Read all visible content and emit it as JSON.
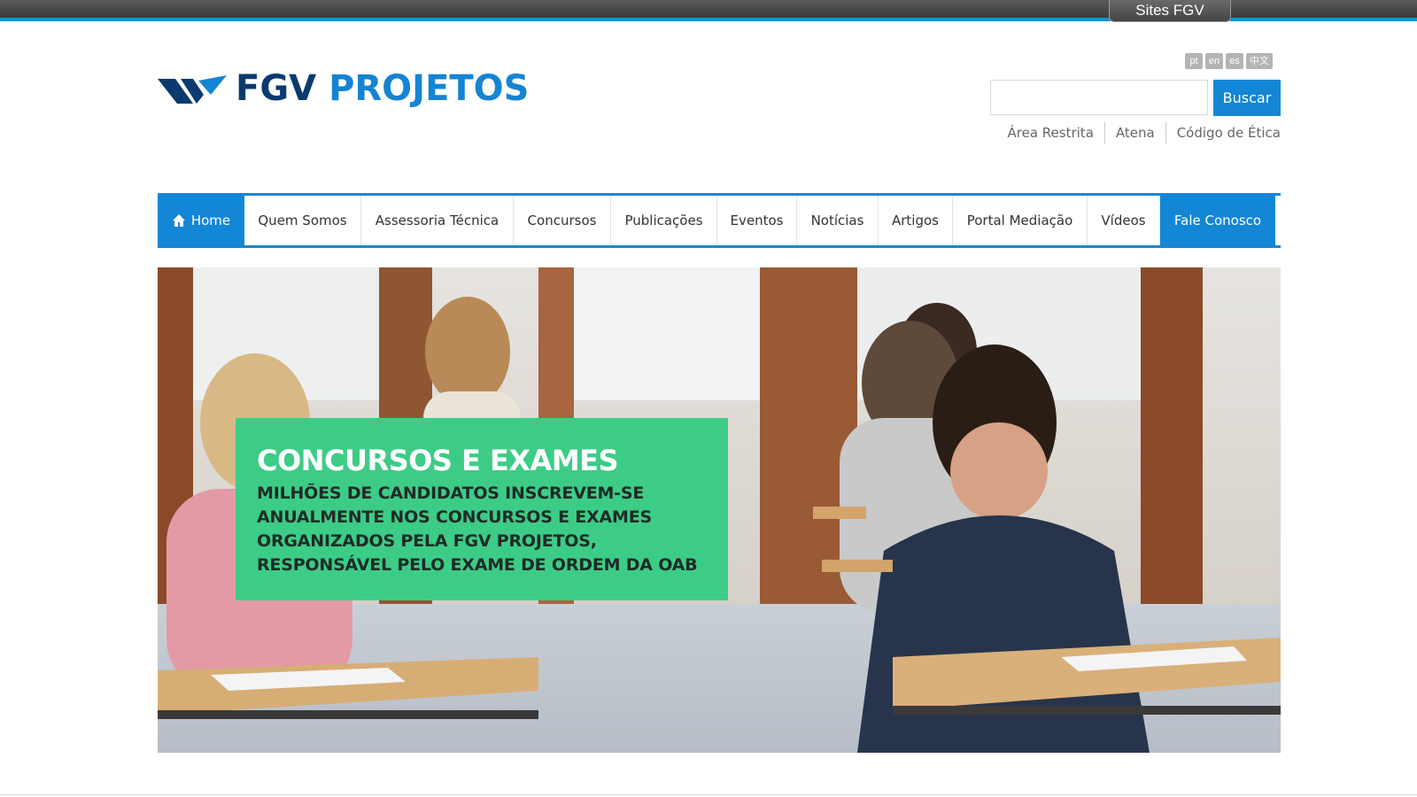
{
  "topbar": {
    "sites_label": "Sites FGV",
    "accent_color": "#1f8dd6"
  },
  "logo": {
    "part1": "FGV",
    "part2": "PROJETOS",
    "color_dark": "#0b3a6e",
    "color_light": "#1584d2"
  },
  "languages": [
    {
      "code": "pt"
    },
    {
      "code": "en"
    },
    {
      "code": "es"
    },
    {
      "code": "中文"
    }
  ],
  "search": {
    "value": "",
    "placeholder": "",
    "button_label": "Buscar"
  },
  "util_links": [
    {
      "label": "Área Restrita"
    },
    {
      "label": "Atena"
    },
    {
      "label": "Código de Ética"
    }
  ],
  "nav": {
    "items": [
      {
        "label": "Home",
        "icon": "home-icon",
        "active": true
      },
      {
        "label": "Quem Somos"
      },
      {
        "label": "Assessoria Técnica"
      },
      {
        "label": "Concursos"
      },
      {
        "label": "Publicações"
      },
      {
        "label": "Eventos"
      },
      {
        "label": "Notícias"
      },
      {
        "label": "Artigos"
      },
      {
        "label": "Portal Mediação"
      },
      {
        "label": "Vídeos"
      },
      {
        "label": "Fale Conosco",
        "highlight": true
      }
    ],
    "accent_color": "#1486d6"
  },
  "hero": {
    "title": "CONCURSOS E EXAMES",
    "text": "MILHÕES DE CANDIDATOS INSCREVEM-SE ANUALMENTE NOS CONCURSOS E EXAMES ORGANIZADOS PELA FGV PROJETOS, RESPONSÁVEL PELO EXAME DE ORDEM DA OAB",
    "box_color": "#3dcc86",
    "image": "students-taking-exam-photo"
  }
}
